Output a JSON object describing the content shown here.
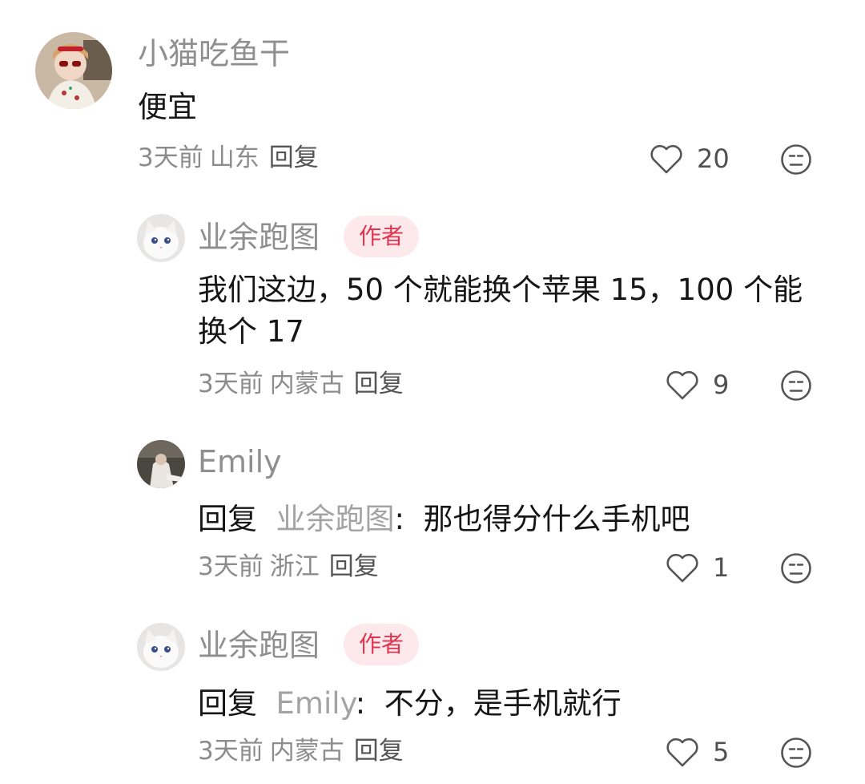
{
  "comments": [
    {
      "author": "小猫吃鱼干",
      "text": "便宜",
      "time": "3天前",
      "location": "山东",
      "reply_label": "回复",
      "likes": "20"
    },
    {
      "author": "业余跑图",
      "badge": "作者",
      "text": "我们这边，50 个就能换个苹果 15，100 个能换个 17",
      "time": "3天前",
      "location": "内蒙古",
      "reply_label": "回复",
      "likes": "9"
    },
    {
      "author": "Emily",
      "reply_prefix": "回复",
      "reply_target": "业余跑图",
      "reply_sep": ":",
      "text": "那也得分什么手机吧",
      "time": "3天前",
      "location": "浙江",
      "reply_label": "回复",
      "likes": "1"
    },
    {
      "author": "业余跑图",
      "badge": "作者",
      "reply_prefix": "回复",
      "reply_target": "Emily",
      "reply_sep": ":",
      "text": "不分，是手机就行",
      "time": "3天前",
      "location": "内蒙古",
      "reply_label": "回复",
      "likes": "5"
    }
  ],
  "icons": {
    "like": "heart-outline-icon",
    "emoji": "neutral-face-icon"
  },
  "colors": {
    "badge_bg": "#fde9ec",
    "badge_text": "#e0344f",
    "name": "#8f8f8f",
    "meta": "#8c8c8c"
  }
}
